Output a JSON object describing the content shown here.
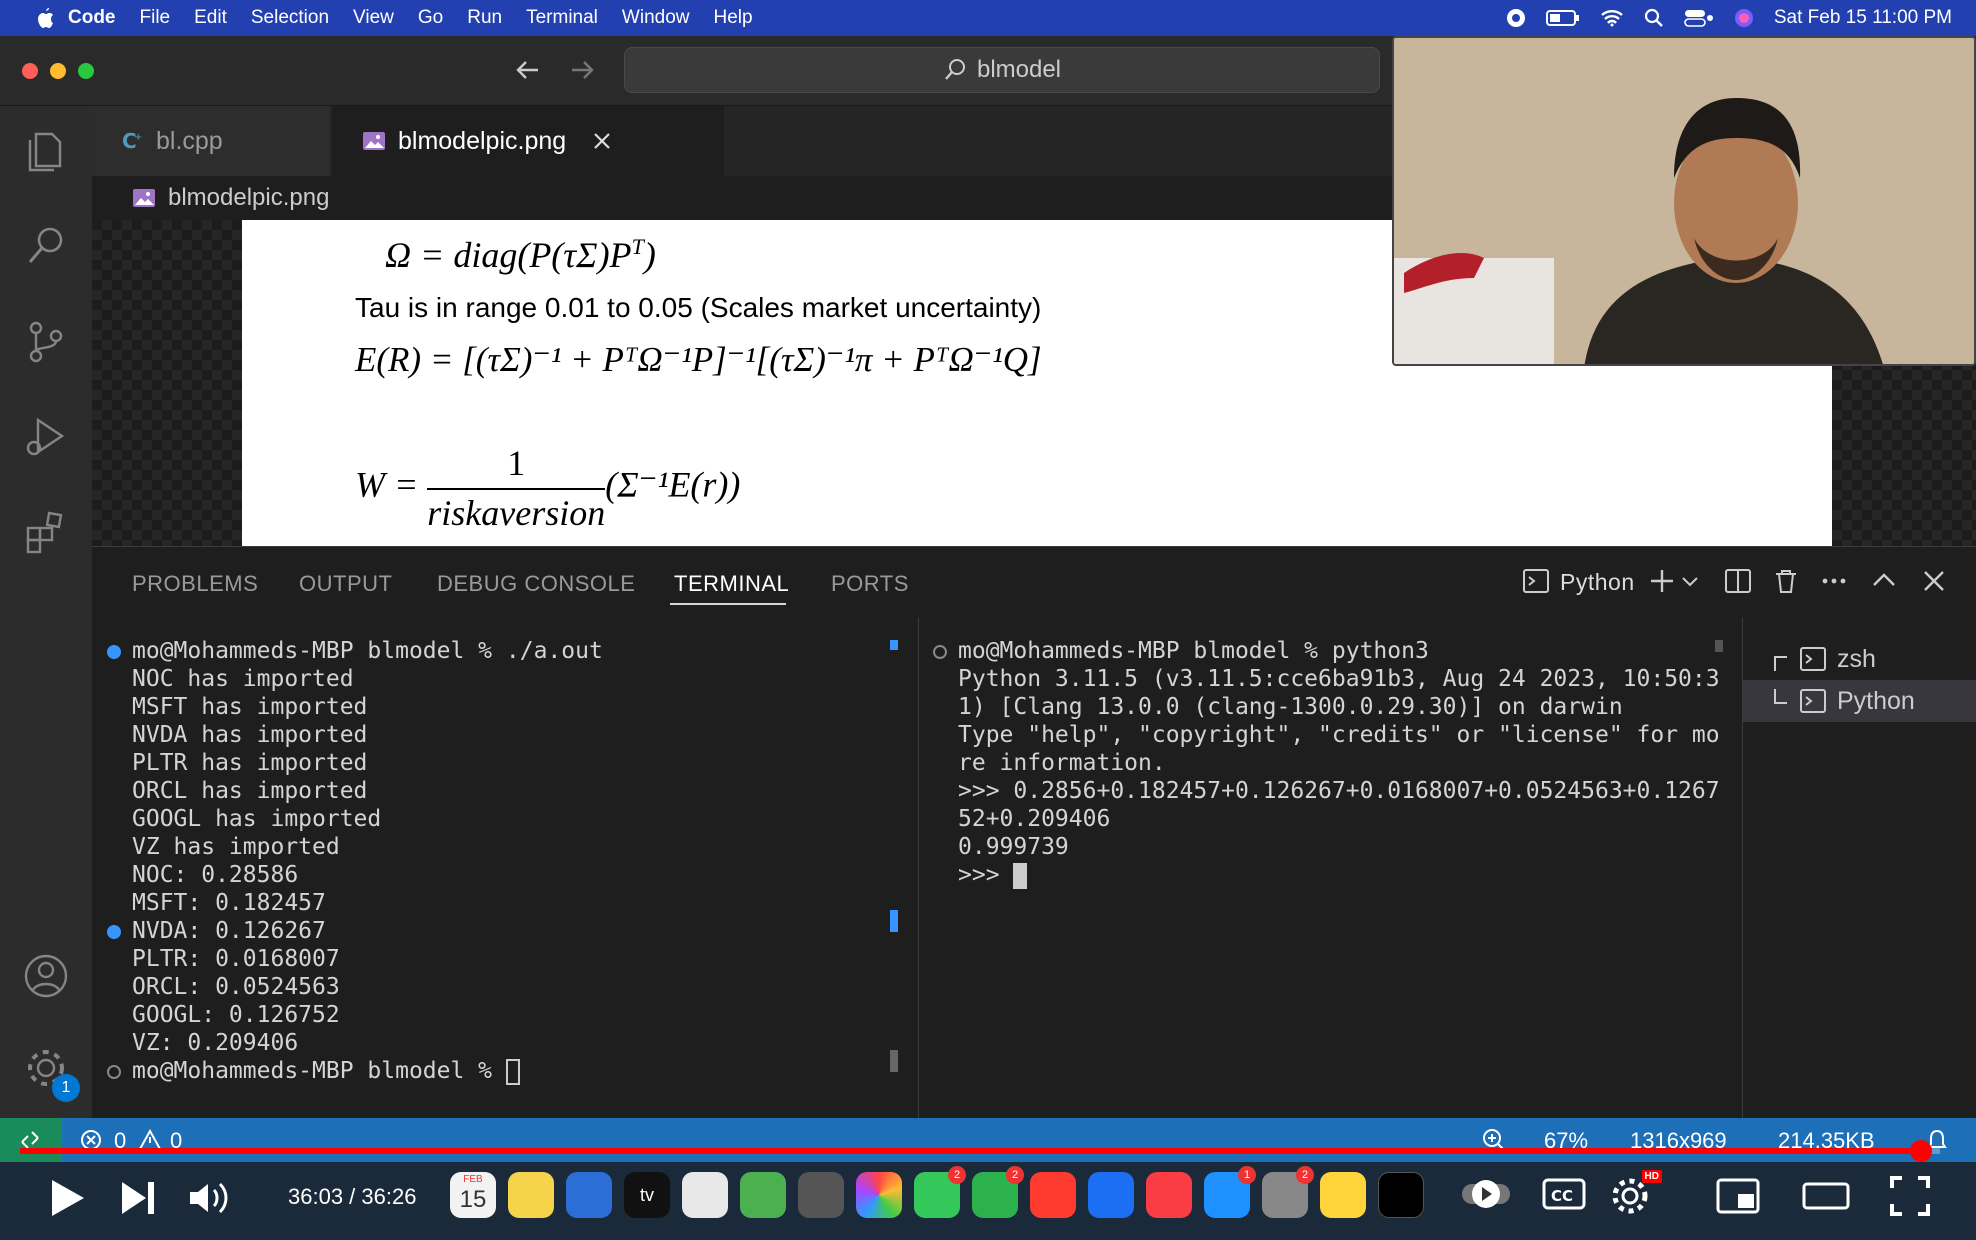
{
  "menubar": {
    "app": "Code",
    "items": [
      "File",
      "Edit",
      "Selection",
      "View",
      "Go",
      "Run",
      "Terminal",
      "Window",
      "Help"
    ],
    "datetime": "Sat Feb 15  11:00 PM"
  },
  "window": {
    "search": "blmodel"
  },
  "tabs": [
    {
      "label": "bl.cpp",
      "icon": "cpp-file-icon"
    },
    {
      "label": "blmodelpic.png",
      "icon": "image-file-icon",
      "active": true
    }
  ],
  "breadcrumb": "blmodelpic.png",
  "image_content": {
    "eq1_left": "Ω = diag(P(τΣ)P",
    "eq1_sup": "T",
    "eq1_right": ")",
    "tau_text": "Tau is in range 0.01 to 0.05 (Scales market uncertainty)",
    "eq2": "E(R) = [(τΣ)⁻¹ + PᵀΩ⁻¹P]⁻¹[(τΣ)⁻¹π + PᵀΩ⁻¹Q]",
    "eq3_lhs": "W =",
    "eq3_num": "1",
    "eq3_den": "riskaversion",
    "eq3_rhs": "(Σ⁻¹E(r))"
  },
  "panel": {
    "tabs": [
      "PROBLEMS",
      "OUTPUT",
      "DEBUG CONSOLE",
      "TERMINAL",
      "PORTS"
    ],
    "active_tab": "TERMINAL",
    "current_terminal": "Python",
    "terminal_list": [
      "zsh",
      "Python"
    ]
  },
  "terminal_left": [
    "mo@Mohammeds-MBP blmodel % ./a.out",
    "NOC has imported",
    "MSFT has imported",
    "NVDA has imported",
    "PLTR has imported",
    "ORCL has imported",
    "GOOGL has imported",
    "VZ has imported",
    "NOC: 0.28586",
    "MSFT: 0.182457",
    "NVDA: 0.126267",
    "PLTR: 0.0168007",
    "ORCL: 0.0524563",
    "GOOGL: 0.126752",
    "VZ: 0.209406",
    "mo@Mohammeds-MBP blmodel % "
  ],
  "terminal_right": [
    "mo@Mohammeds-MBP blmodel % python3",
    "Python 3.11.5 (v3.11.5:cce6ba91b3, Aug 24 2023, 10:50:3",
    "1) [Clang 13.0.0 (clang-1300.0.29.30)] on darwin",
    "Type \"help\", \"copyright\", \"credits\" or \"license\" for mo",
    "re information.",
    ">>> 0.2856+0.182457+0.126267+0.0168007+0.0524563+0.1267",
    "52+0.209406",
    "0.999739",
    ">>> "
  ],
  "statusbar": {
    "errors": "0",
    "warnings": "0",
    "zoom": "67%",
    "dimensions": "1316x969",
    "filesize": "214.35KB"
  },
  "settings_badge": "1",
  "video": {
    "time": "36:03 / 36:26",
    "progress": 0.99,
    "hd_label": "HD"
  },
  "dock": {
    "calendar_month": "FEB",
    "calendar_day": "15",
    "tv_label": "tv",
    "badges": [
      "2",
      "2",
      "1",
      "2"
    ]
  },
  "colors": {
    "menubar": "#2340b0",
    "statusbar": "#1d6fb8",
    "progress": "#ff0000",
    "accent": "#0078d4"
  }
}
